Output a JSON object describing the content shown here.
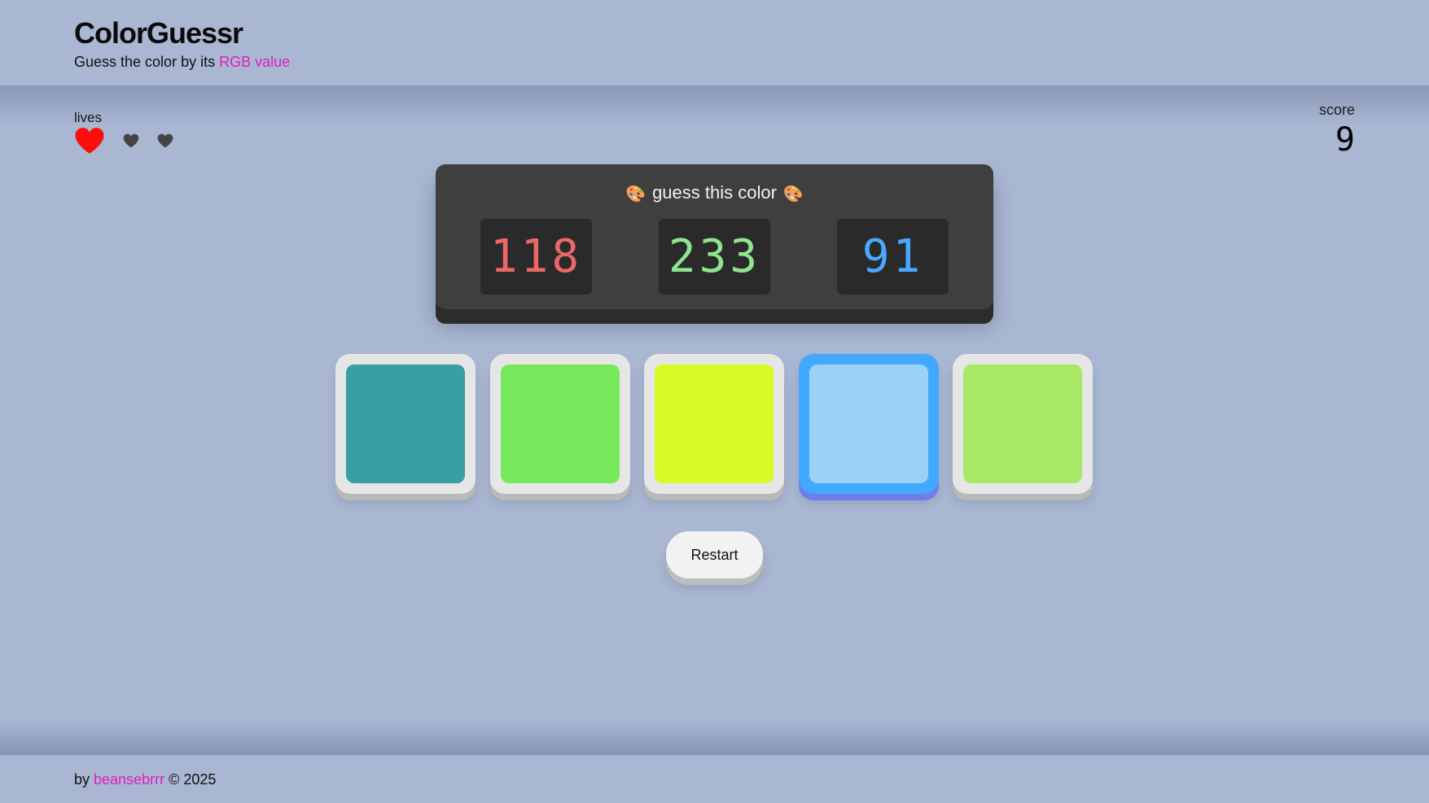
{
  "header": {
    "title": "ColorGuessr",
    "subtitle_prefix": "Guess the color by its ",
    "subtitle_accent": "RGB value"
  },
  "lives": {
    "label": "lives",
    "total": 3,
    "remaining": 1,
    "icon": "heart-icon"
  },
  "score": {
    "label": "score",
    "value": "9"
  },
  "target": {
    "prompt": "guess this color",
    "icon": "palette-icon",
    "r": "118",
    "g": "233",
    "b": "91",
    "colors": {
      "r": "#ec6767",
      "g": "#8fe68f",
      "b": "#49a9ff"
    }
  },
  "swatches": [
    {
      "color": "#389fa2",
      "selected": false
    },
    {
      "color": "#77e85c",
      "selected": false
    },
    {
      "color": "#d7fb24",
      "selected": false
    },
    {
      "color": "#9ad1f4",
      "selected": true
    },
    {
      "color": "#a8e867",
      "selected": false
    }
  ],
  "restart_label": "Restart",
  "footer": {
    "prefix": "by ",
    "author": "beansebrrr",
    "suffix": " © 2025"
  },
  "colors": {
    "accent": "#e11ebd",
    "background": "#a9b7d3",
    "selected_border": "#43a8ff",
    "heart_active": "#ff0d0d",
    "heart_lost": "#444444"
  }
}
